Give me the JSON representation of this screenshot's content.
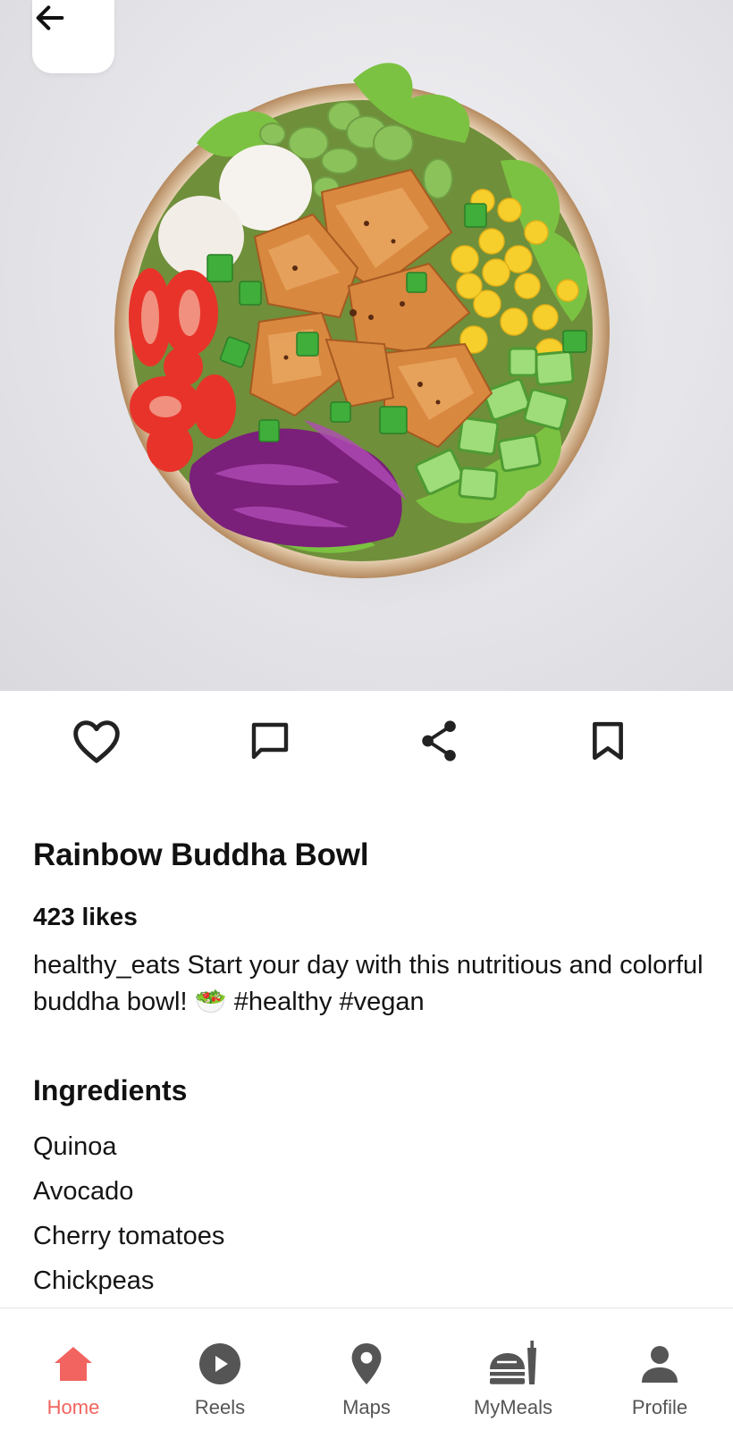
{
  "post": {
    "title": "Rainbow Buddha Bowl",
    "likes": "423 likes",
    "caption_user": "healthy_eats",
    "caption_text": "Start your day with this nutritious and colorful buddha bowl!",
    "caption_emoji": "🥗",
    "caption_tags": "#healthy #vegan"
  },
  "actions": {
    "like_icon": "heart-outline-icon",
    "comment_icon": "comment-outline-icon",
    "share_icon": "share-icon",
    "save_icon": "bookmark-outline-icon"
  },
  "ingredients": {
    "heading": "Ingredients",
    "items": [
      "Quinoa",
      "Avocado",
      "Cherry tomatoes",
      "Chickpeas"
    ]
  },
  "nav": {
    "items": [
      {
        "label": "Home",
        "icon": "home-icon",
        "active": true
      },
      {
        "label": "Reels",
        "icon": "play-circle-icon",
        "active": false
      },
      {
        "label": "Maps",
        "icon": "map-pin-icon",
        "active": false
      },
      {
        "label": "MyMeals",
        "icon": "meals-icon",
        "active": false
      },
      {
        "label": "Profile",
        "icon": "person-icon",
        "active": false
      }
    ]
  },
  "colors": {
    "accent": "#f2645f",
    "icon": "#222222",
    "nav_inactive": "#555555"
  }
}
